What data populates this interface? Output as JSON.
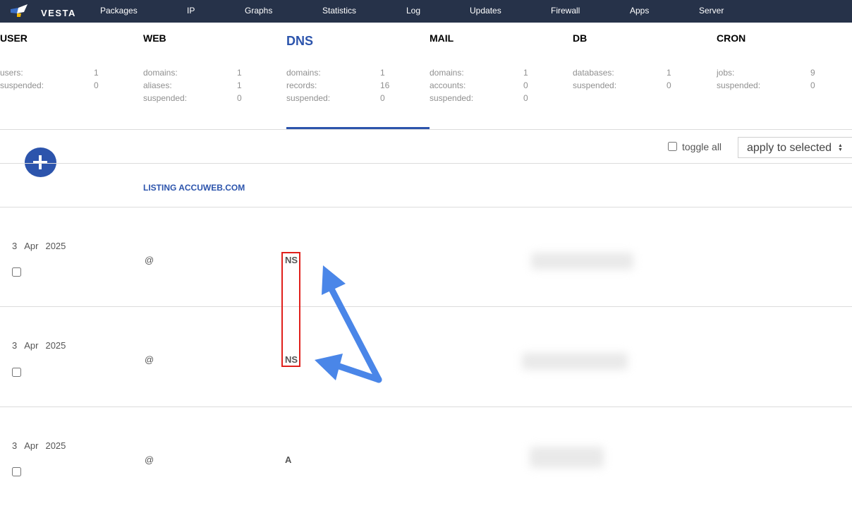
{
  "nav": {
    "logo": "VESTA",
    "items": [
      "Packages",
      "IP",
      "Graphs",
      "Statistics",
      "Log",
      "Updates",
      "Firewall",
      "Apps",
      "Server"
    ]
  },
  "stats": [
    {
      "title": "USER",
      "rows": [
        {
          "label": "users:",
          "value": "1"
        },
        {
          "label": "suspended:",
          "value": "0"
        }
      ]
    },
    {
      "title": "WEB",
      "rows": [
        {
          "label": "domains:",
          "value": "1"
        },
        {
          "label": "aliases:",
          "value": "1"
        },
        {
          "label": "suspended:",
          "value": "0"
        }
      ]
    },
    {
      "title": "DNS",
      "rows": [
        {
          "label": "domains:",
          "value": "1"
        },
        {
          "label": "records:",
          "value": "16"
        },
        {
          "label": "suspended:",
          "value": "0"
        }
      ]
    },
    {
      "title": "MAIL",
      "rows": [
        {
          "label": "domains:",
          "value": "1"
        },
        {
          "label": "accounts:",
          "value": "0"
        },
        {
          "label": "suspended:",
          "value": "0"
        }
      ]
    },
    {
      "title": "DB",
      "rows": [
        {
          "label": "databases:",
          "value": "1"
        },
        {
          "label": "suspended:",
          "value": "0"
        }
      ]
    },
    {
      "title": "CRON",
      "rows": [
        {
          "label": "jobs:",
          "value": "9"
        },
        {
          "label": "suspended:",
          "value": "0"
        }
      ]
    }
  ],
  "toolbar": {
    "toggle_all": "toggle all",
    "apply_selected": "apply to selected"
  },
  "listing_title": "LISTING ACCUWEB.COM",
  "records": [
    {
      "day": "3",
      "month": "Apr",
      "year": "2025",
      "name": "@",
      "type": "NS"
    },
    {
      "day": "3",
      "month": "Apr",
      "year": "2025",
      "name": "@",
      "type": "NS"
    },
    {
      "day": "3",
      "month": "Apr",
      "year": "2025",
      "name": "@",
      "type": "A"
    }
  ],
  "colors": {
    "nav_bg": "#263249",
    "accent": "#2c54ac",
    "highlight": "#e0201c",
    "arrow": "#4a86e8"
  }
}
